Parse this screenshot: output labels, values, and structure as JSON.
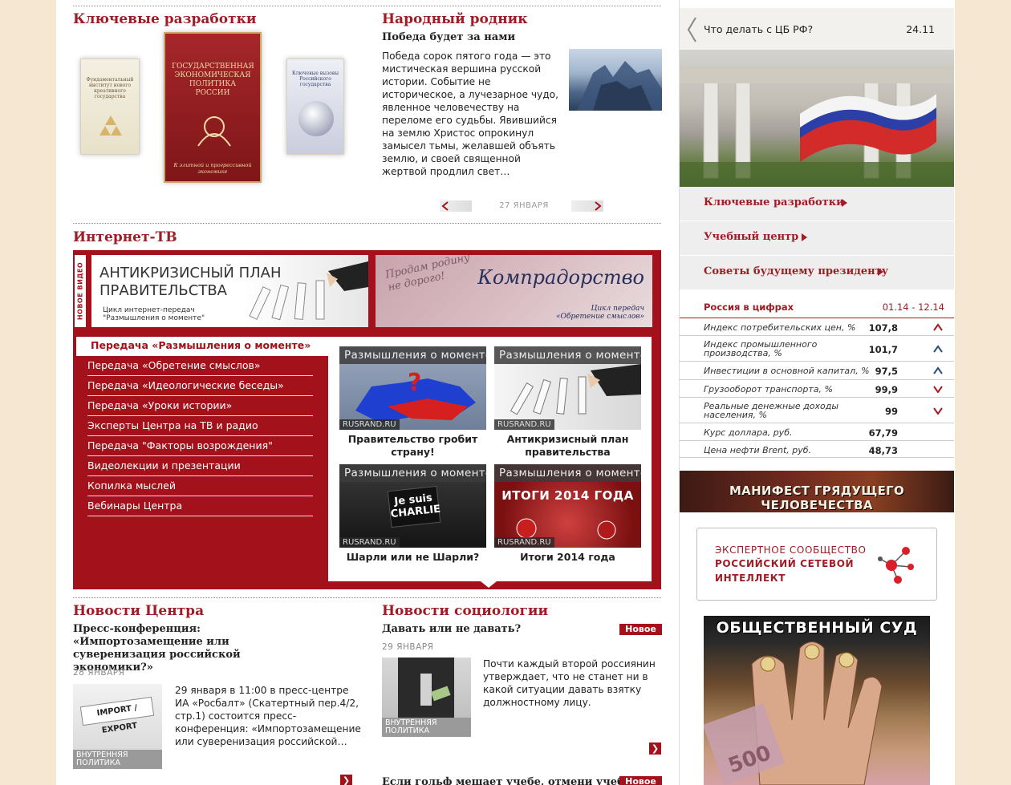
{
  "key_dev": {
    "title": "Ключевые разработки",
    "books": [
      {
        "text": "Фундаментальный институт нового креативного государства"
      },
      {
        "text": "ГОСУДАРСТВЕННАЯ ЭКОНОМИЧЕСКАЯ ПОЛИТИКА РОССИИ",
        "sub": "К элитной и прогрессивной экономике"
      },
      {
        "text": "Ключевые вызовы Российского государства"
      }
    ]
  },
  "narodny": {
    "title": "Народный родник",
    "headline": "Победа будет за нами",
    "body": "Победа сорок пятого года — это мистическая вершина русской истории. Событие не историческое, а лучезарное чудо, явленное человечеству на переломе его судьбы. Явившийся на землю Христос опрокинул замысел тьмы, желавшей объять землю, и своей священной жертвой продлил свет…",
    "date": "27 ЯНВАРЯ"
  },
  "tv": {
    "title": "Интернет-ТВ",
    "vertical": "НОВОЕ ВИДЕО",
    "banner1": {
      "title_l1": "АНТИКРИЗИСНЫЙ ПЛАН",
      "title_l2": "ПРАВИТЕЛЬСТВА",
      "sub_l1": "Цикл интернет-передач",
      "sub_l2": "\"Размышления о моменте\""
    },
    "banner2": {
      "stamp_l1": "Продам родину",
      "stamp_l2": "не дорого!",
      "title": "Компрадорство",
      "sub_l1": "Цикл передач",
      "sub_l2": "«Обретение смыслов»"
    },
    "menu": [
      "Передача «Размышления о моменте»",
      "Передача «Обретение смыслов»",
      "Передача «Идеологические беседы»",
      "Передача «Уроки истории»",
      "Эксперты Центра на ТВ и радио",
      "Передача \"Факторы возрождения\"",
      "Видеолекции и презентации",
      "Копилка мыслей",
      "Вебинары Центра"
    ],
    "videos": [
      {
        "caption": "Размышления о моменте",
        "src": "RUSRAND.RU",
        "title": "Правительство гробит страну!"
      },
      {
        "caption": "Размышления о моменте",
        "src": "RUSRAND.RU",
        "title": "Антикризисный план правительства"
      },
      {
        "caption": "Размышления о моменте",
        "src": "RUSRAND.RU",
        "title": "Шарли или не Шарли?",
        "overlay_l1": "Je suis",
        "overlay_l2": "CHARLIE"
      },
      {
        "caption": "Размышления о моменте",
        "src": "RUSRAND.RU",
        "title": "Итоги 2014 года",
        "overlay": "ИТОГИ 2014 ГОДА"
      }
    ]
  },
  "news_center": {
    "title": "Новости Центра",
    "headline": "Пресс-конференция: «Импортозамещение или суверенизация российской экономики?»",
    "date": "28 ЯНВАРЯ",
    "img_text": "IMPORT / EXPORT",
    "body": "29 января в 11:00 в пресс-центре ИА «Росбалт» (Скатертный пер.4/2, стр.1) состоится пресс-конференция: «Импортозамещение или суверенизация российской…",
    "rubric": "ВНУТРЕННЯЯ ПОЛИТИКА"
  },
  "news_socio": {
    "title": "Новости социологии",
    "headline": "Давать или не давать?",
    "tag": "Новое",
    "date": "29 ЯНВАРЯ",
    "body": "Почти каждый второй россиянин утверждает, что не станет ни в какой ситуации давать взятку должностному лицу.",
    "rubric": "ВНУТРЕННЯЯ ПОЛИТИКА",
    "next_headline": "Если гольф мешает учебе, отмени учебу!",
    "next_tag": "Новое"
  },
  "sidebar": {
    "cb_title": "Что делать с ЦБ РФ?",
    "cb_date": "24.11",
    "links": [
      "Ключевые разработки",
      "Учебный центр",
      "Советы будущему президенту"
    ],
    "stats_title": "Россия в цифрах",
    "stats_period": "01.14 - 12.14",
    "stats": [
      {
        "l1": "Индекс потребительских цен, %",
        "value": "107,8",
        "dir": "up"
      },
      {
        "l1": "Индекс промышленного",
        "l2": "производства, %",
        "value": "101,7",
        "dir": "up"
      },
      {
        "l1": "Инвестиции в основной капитал, %",
        "value": "97,5",
        "dir": "up"
      },
      {
        "l1": "Грузооборот транспорта, %",
        "value": "99,9",
        "dir": "down"
      },
      {
        "l1": "Реальные денежные доходы",
        "l2": "населения, %",
        "value": "99",
        "dir": "down"
      },
      {
        "l1": "Курс доллара, руб.",
        "value": "67,79",
        "dir": ""
      },
      {
        "l1": "Цена нефти Brent, руб.",
        "value": "48,73",
        "dir": ""
      }
    ],
    "manifest": "МАНИФЕСТ ГРЯДУЩЕГО ЧЕЛОВЕЧЕСТВА",
    "expert_l1": "ЭКСПЕРТНОЕ СООБЩЕСТВО",
    "expert_l2": "РОССИЙСКИЙ СЕТЕВОЙ",
    "expert_l3": "ИНТЕЛЛЕКТ",
    "sud": "ОБЩЕСТВЕННЫЙ СУД",
    "sud_note": "500"
  },
  "colors": {
    "accent": "#a3111b",
    "bg": "#f6e7d2"
  }
}
